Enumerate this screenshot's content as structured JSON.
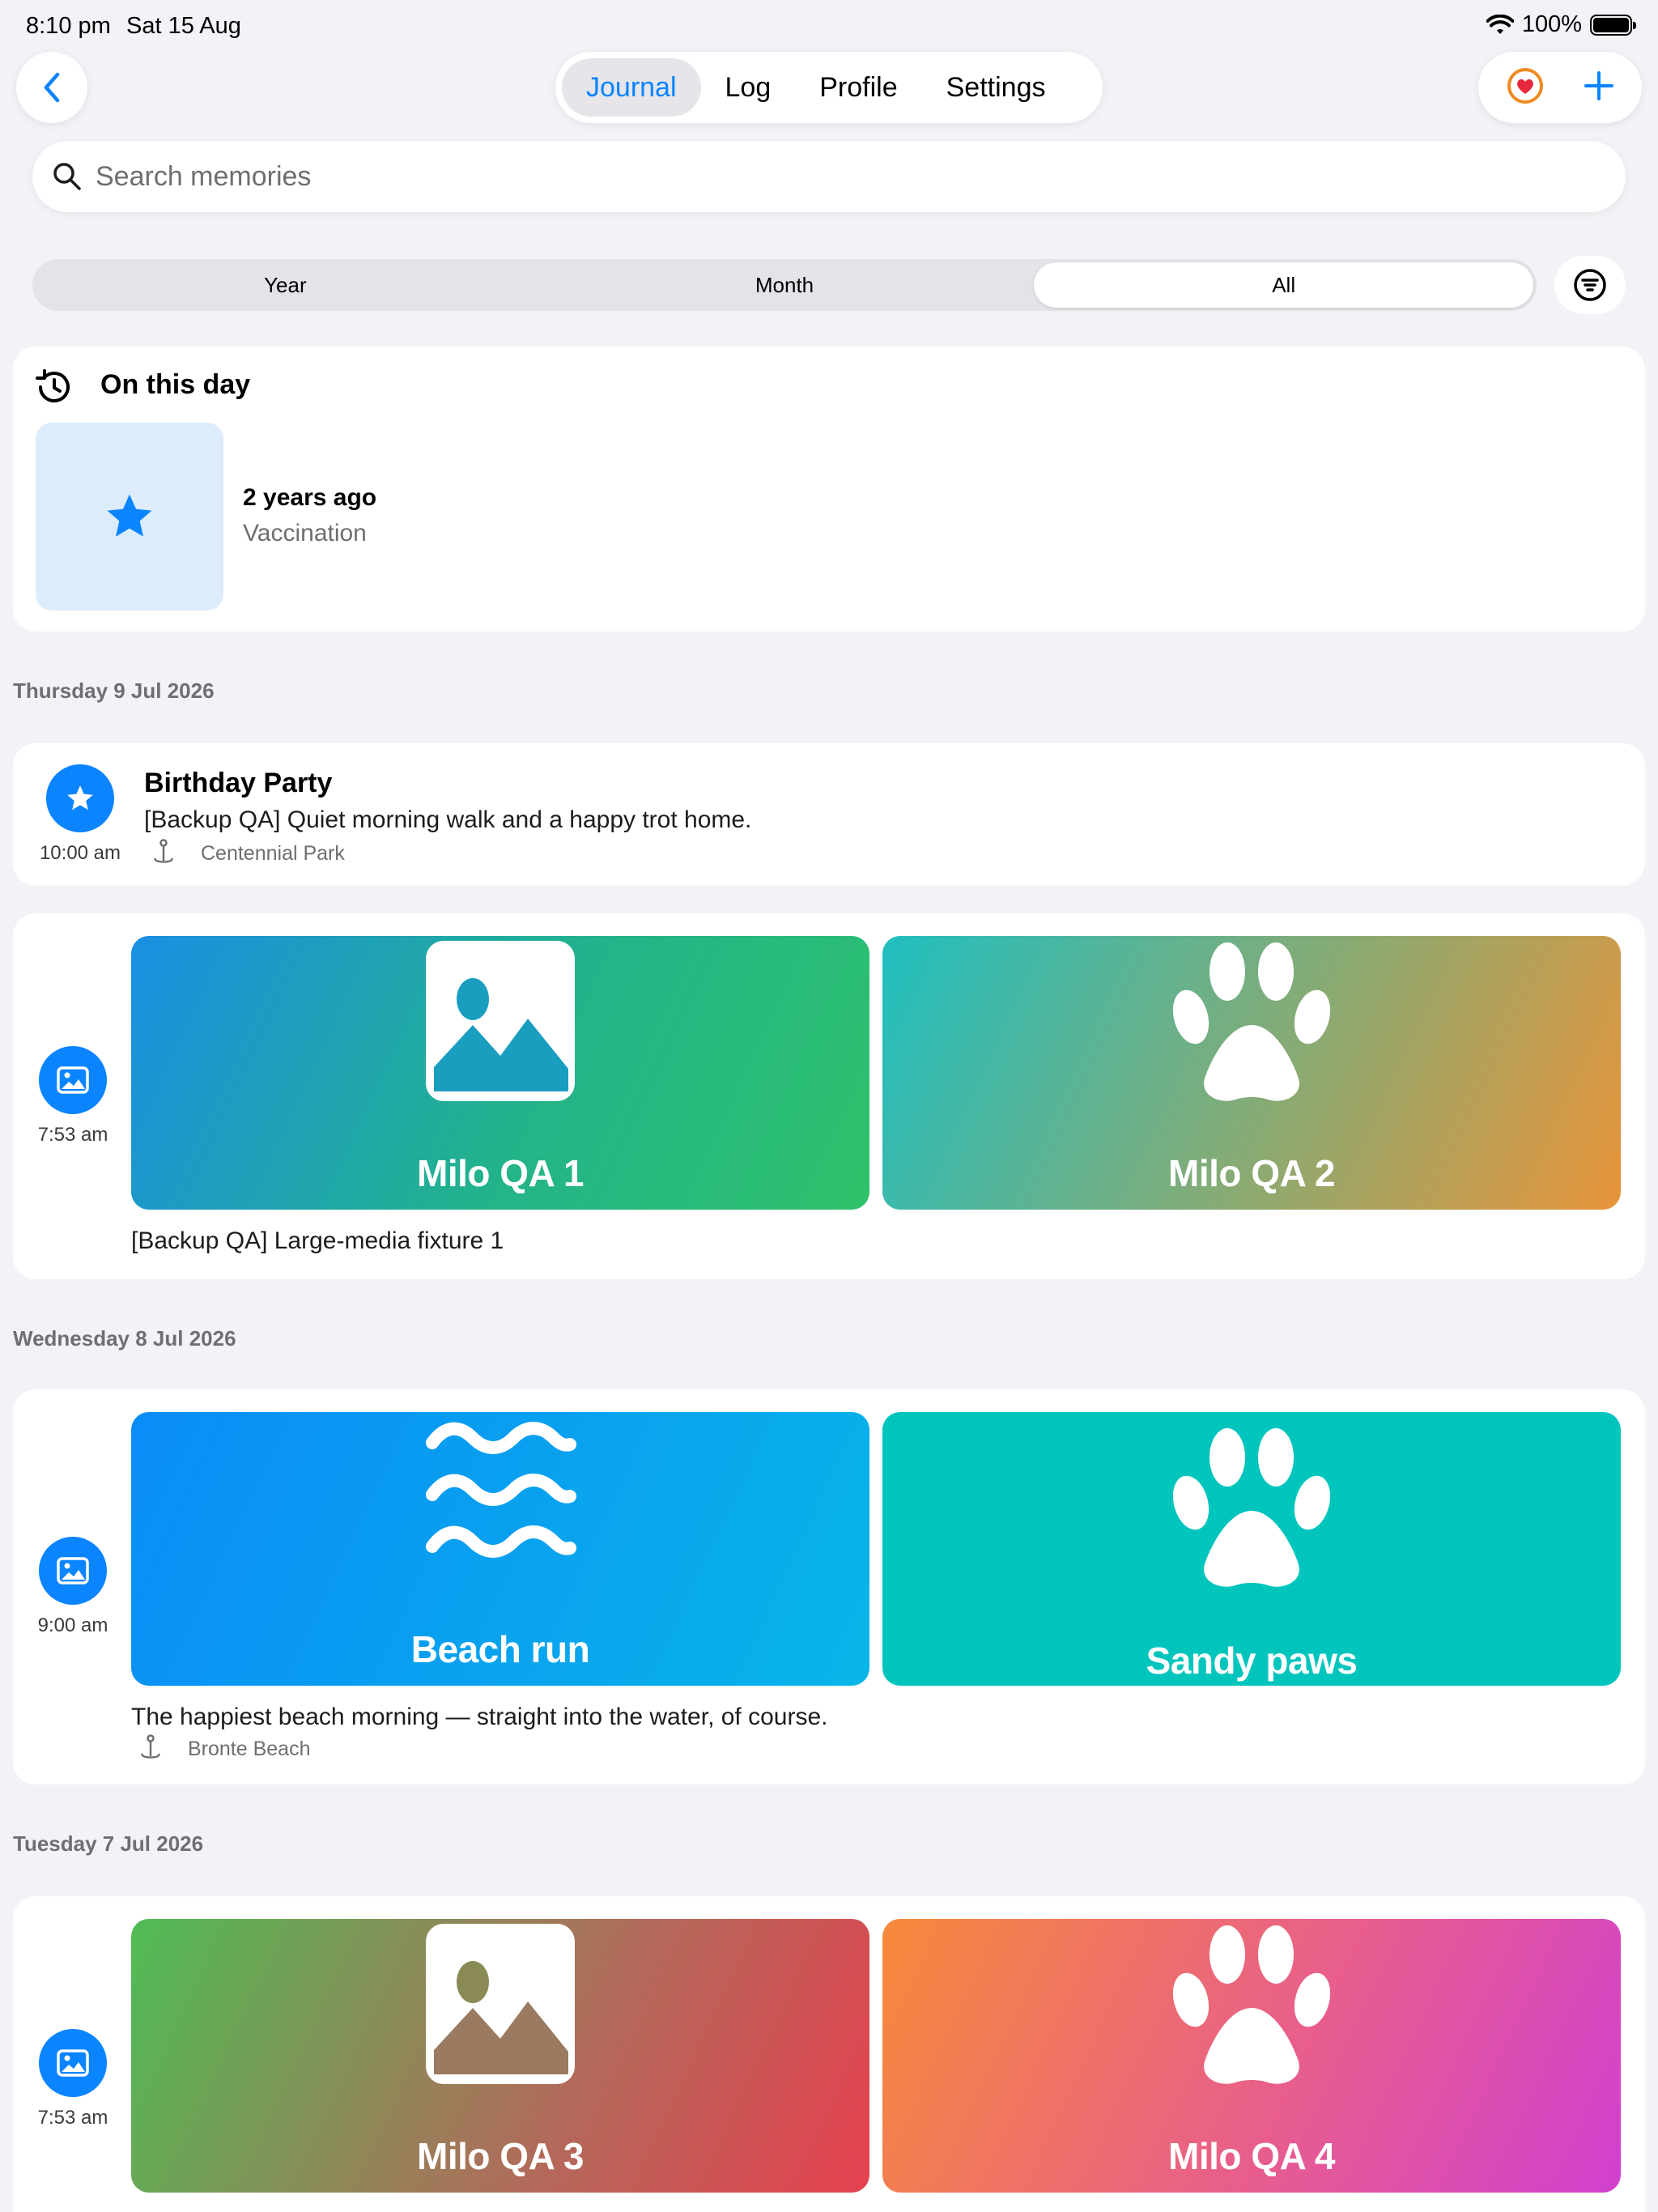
{
  "status": {
    "time": "8:10 pm",
    "date": "Sat 15 Aug",
    "battery": "100%"
  },
  "nav": {
    "tabs": [
      {
        "label": "Journal",
        "active": true
      },
      {
        "label": "Log",
        "active": false
      },
      {
        "label": "Profile",
        "active": false
      },
      {
        "label": "Settings",
        "active": false
      }
    ],
    "back_icon": "chevron-left-icon",
    "favorite_icon": "heart-icon",
    "add_icon": "plus-icon"
  },
  "search": {
    "placeholder": "Search memories"
  },
  "segments": [
    {
      "label": "Year",
      "active": false
    },
    {
      "label": "Month",
      "active": false
    },
    {
      "label": "All",
      "active": true
    }
  ],
  "on_this_day": {
    "title": "On this day",
    "when": "2 years ago",
    "what": "Vaccination"
  },
  "days": [
    {
      "header": "Thursday 9 Jul 2026",
      "entries": [
        {
          "time": "10:00 am",
          "title": "Birthday Party",
          "text": "[Backup QA] Quiet morning walk and a happy trot home.",
          "location": "Centennial Park"
        },
        {
          "time": "7:53 am",
          "media": [
            {
              "caption": "Milo QA 1"
            },
            {
              "caption": "Milo QA 2"
            }
          ],
          "text": "[Backup QA] Large-media fixture 1"
        }
      ]
    },
    {
      "header": "Wednesday 8 Jul 2026",
      "entries": [
        {
          "time": "9:00 am",
          "media": [
            {
              "caption": "Beach run"
            },
            {
              "caption": "Sandy paws"
            }
          ],
          "text": "The happiest beach morning — straight into the water, of course.",
          "location": "Bronte Beach"
        }
      ]
    },
    {
      "header": "Tuesday 7 Jul 2026",
      "entries": [
        {
          "time": "7:53 am",
          "media": [
            {
              "caption": "Milo QA 3"
            },
            {
              "caption": "Milo QA 4"
            }
          ]
        }
      ]
    }
  ],
  "colors": {
    "accent": "#0a84ff",
    "background": "#f2f2f7"
  }
}
